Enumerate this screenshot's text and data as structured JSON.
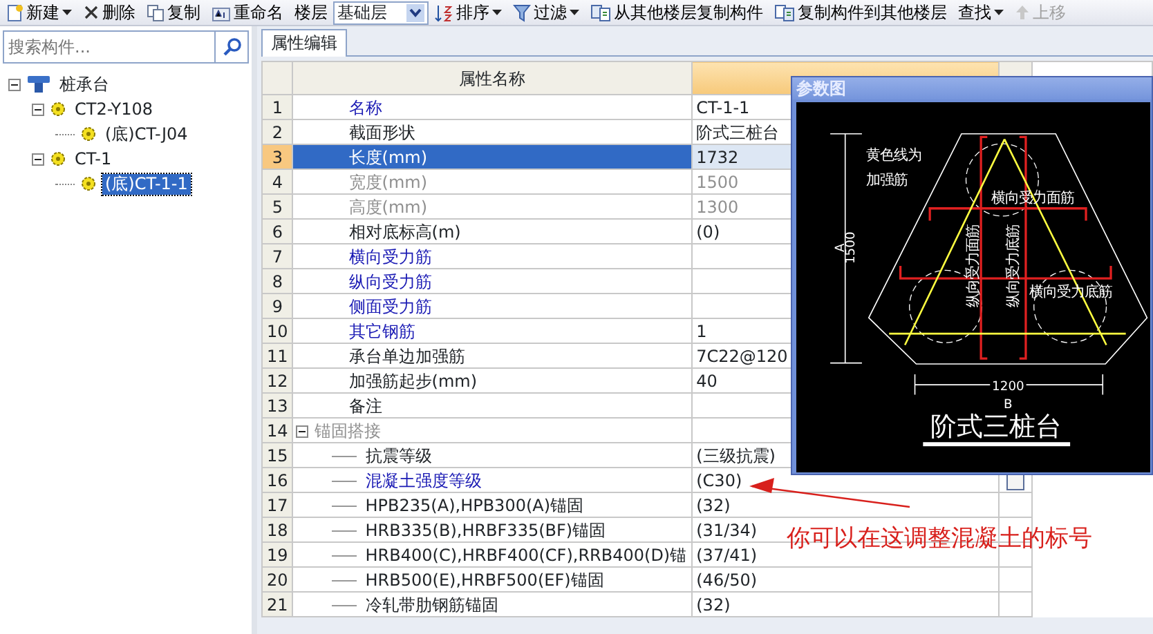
{
  "toolbar": [
    {
      "label": "新建",
      "kind": "dropdown"
    },
    {
      "label": "删除",
      "kind": "button"
    },
    {
      "label": "复制",
      "kind": "button"
    },
    {
      "label": "重命名",
      "kind": "button"
    },
    {
      "label": "楼层",
      "kind": "label"
    },
    {
      "label": "基础层",
      "kind": "select"
    },
    {
      "label": "排序",
      "kind": "dropdown"
    },
    {
      "label": "过滤",
      "kind": "dropdown"
    },
    {
      "label": "从其他楼层复制构件",
      "kind": "button"
    },
    {
      "label": "复制构件到其他楼层",
      "kind": "button"
    },
    {
      "label": "查找",
      "kind": "dropdown"
    },
    {
      "label": "上移",
      "kind": "disabled"
    }
  ],
  "search": {
    "placeholder": "搜索构件..."
  },
  "tree": [
    {
      "label": "桩承台",
      "kind": "root",
      "selected": false,
      "expanded": true,
      "children": [
        {
          "label": "CT2-Y108",
          "kind": "node",
          "selected": false,
          "expanded": true,
          "children": [
            {
              "label": "(底)CT-J04",
              "kind": "node",
              "selected": false
            }
          ]
        },
        {
          "label": "CT-1",
          "kind": "node",
          "selected": false,
          "expanded": true,
          "children": [
            {
              "label": "(底)CT-1-1",
              "kind": "node",
              "selected": true
            }
          ]
        }
      ]
    }
  ],
  "tabs": [
    {
      "label": "属性编辑",
      "selected": true
    }
  ],
  "table": {
    "columns": [
      "属性名称"
    ],
    "rows": [
      {
        "number": "1",
        "name": "名称",
        "value": "CT-1-1",
        "kind": "link",
        "selected": false
      },
      {
        "number": "2",
        "name": "截面形状",
        "value": "阶式三桩台",
        "kind": "normal",
        "selected": false
      },
      {
        "number": "3",
        "name": "长度(mm)",
        "value": "1732",
        "kind": "link",
        "selected": true
      },
      {
        "number": "4",
        "name": "宽度(mm)",
        "value": "1500",
        "kind": "disabled",
        "selected": false
      },
      {
        "number": "5",
        "name": "高度(mm)",
        "value": "1300",
        "kind": "disabled",
        "selected": false
      },
      {
        "number": "6",
        "name": "相对底标高(m)",
        "value": "(0)",
        "kind": "normal",
        "selected": false
      },
      {
        "number": "7",
        "name": "横向受力筋",
        "kind": "link",
        "selected": false
      },
      {
        "number": "8",
        "name": "纵向受力筋",
        "kind": "link",
        "selected": false
      },
      {
        "number": "9",
        "name": "侧面受力筋",
        "kind": "link",
        "selected": false
      },
      {
        "number": "10",
        "name": "其它钢筋",
        "value": "1",
        "kind": "link",
        "selected": false
      },
      {
        "number": "11",
        "name": "承台单边加强筋",
        "value": "7C22@120",
        "kind": "normal",
        "selected": false
      },
      {
        "number": "12",
        "name": "加强筋起步(mm)",
        "value": "40",
        "kind": "normal",
        "selected": false
      },
      {
        "number": "13",
        "name": "备注",
        "kind": "normal",
        "selected": false
      },
      {
        "number": "14",
        "name": "锚固搭接",
        "kind": "disabled",
        "selected": false,
        "expanded": true,
        "children": [
          {
            "number": "15",
            "name": "抗震等级",
            "value": "(三级抗震)",
            "kind": "normal",
            "selected": false
          },
          {
            "number": "16",
            "name": "混凝土强度等级",
            "value": "(C30)",
            "kind": "link",
            "selected": false,
            "checked": false
          },
          {
            "number": "17",
            "name": "HPB235(A),HPB300(A)锚固",
            "value": "(32)",
            "kind": "normal",
            "selected": false
          },
          {
            "number": "18",
            "name": "HRB335(B),HRBF335(BF)锚固",
            "value": "(31/34)",
            "kind": "normal",
            "selected": false
          },
          {
            "number": "19",
            "name": "HRB400(C),HRBF400(CF),RRB400(D)锚",
            "value": "(37/41)",
            "kind": "normal",
            "selected": false
          },
          {
            "number": "20",
            "name": "HRB500(E),HRBF500(EF)锚固",
            "value": "(46/50)",
            "kind": "normal",
            "selected": false
          },
          {
            "number": "21",
            "name": "冷轧带肋钢筋锚固",
            "value": "(32)",
            "kind": "normal",
            "selected": false
          }
        ]
      }
    ]
  },
  "popup": {
    "title": "参数图",
    "labels": [
      "黄色线为",
      "加强筋",
      "横向受力面筋",
      "横向受力底筋",
      "纵向受力面筋",
      "纵向受力底筋",
      "A",
      "1500",
      "1200",
      "B"
    ],
    "caption": "阶式三桩台"
  },
  "annotation": {
    "text": "你可以在这调整混凝土的标号"
  }
}
